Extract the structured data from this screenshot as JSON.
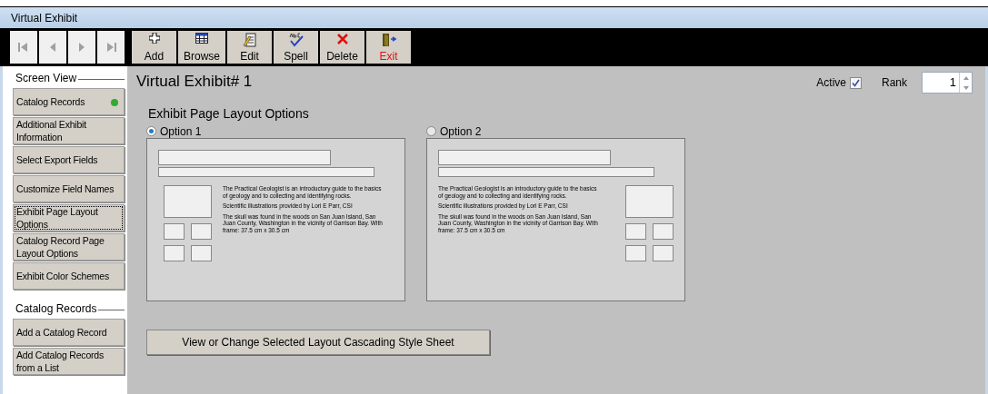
{
  "window": {
    "title": "Virtual Exhibit"
  },
  "toolbar": {
    "nav": [
      {
        "kind": "first",
        "disabled": true
      },
      {
        "kind": "prev",
        "disabled": true
      },
      {
        "kind": "next",
        "disabled": true
      },
      {
        "kind": "last",
        "disabled": true
      }
    ],
    "buttons": [
      {
        "kind": "add",
        "label": "Add"
      },
      {
        "kind": "browse",
        "label": "Browse"
      },
      {
        "kind": "edit",
        "label": "Edit"
      },
      {
        "kind": "spell",
        "label": "Spell"
      },
      {
        "kind": "delete",
        "label": "Delete"
      },
      {
        "kind": "exit",
        "label": "Exit"
      }
    ]
  },
  "sidebar": {
    "sections": [
      {
        "title": "Screen View",
        "items": [
          {
            "label": "Catalog Records",
            "color": "#33aa33",
            "focused": false
          },
          {
            "label": "Additional Exhibit Information",
            "focused": false
          },
          {
            "label": "Select Export Fields",
            "focused": false
          },
          {
            "label": "Customize Field Names",
            "focused": false
          },
          {
            "label": "Exhibit Page Layout Options",
            "focused": true
          },
          {
            "label": "Catalog Record Page Layout Options",
            "focused": false
          },
          {
            "label": "Exhibit Color Schemes",
            "focused": false
          }
        ]
      },
      {
        "title": "Catalog Records",
        "items": [
          {
            "label": "Add a Catalog Record",
            "focused": false
          },
          {
            "label": "Add Catalog Records from a List",
            "focused": false
          }
        ]
      }
    ]
  },
  "header": {
    "title": "Virtual Exhibit# 1",
    "active": {
      "label": "Active",
      "checked": true
    },
    "rank": {
      "label": "Rank",
      "value": "1"
    }
  },
  "layout_options": {
    "title": "Exhibit Page Layout Options",
    "options": [
      {
        "label": "Option 1",
        "selected": true,
        "kind": "images_left",
        "paragraphs": [
          "The Practical Geologist is an introductory guide to the basics of geology and to collecting and identifying rocks.",
          "Scientific illustrations provided by Lori E Parr, CSI",
          "The skull was found in the woods on San Juan Island, San Juan County, Washington in the vicinity of Garrison Bay. With frame: 37.5 cm x 30.5 cm"
        ]
      },
      {
        "label": "Option 2",
        "selected": false,
        "kind": "images_right",
        "paragraphs": [
          "The Practical Geologist is an introductory guide to the basics of geology and to collecting and identifying rocks.",
          "Scientific illustrations provided by Lori E Parr, CSI",
          "The skull was found in the woods on San Juan Island, San Juan County, Washington in the vicinity of Garrison Bay. With frame: 37.5 cm x 30.5 cm"
        ]
      }
    ]
  },
  "css_button": {
    "label": "View or Change Selected Layout Cascading Style Sheet"
  }
}
